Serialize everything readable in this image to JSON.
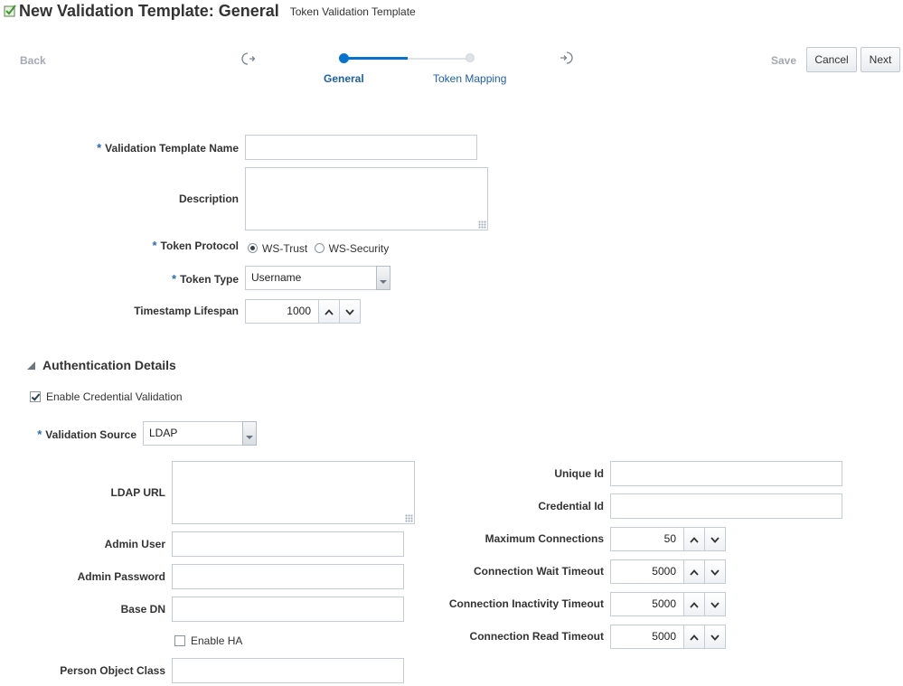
{
  "header": {
    "title": "New Validation Template: General",
    "subtitle": "Token Validation Template"
  },
  "train": {
    "back_label": "Back",
    "steps": [
      {
        "label": "General",
        "state": "current"
      },
      {
        "label": "Token Mapping",
        "state": "next"
      }
    ],
    "save_label": "Save",
    "cancel_label": "Cancel",
    "next_label": "Next"
  },
  "general": {
    "name_label": "Validation Template Name",
    "name_value": "",
    "description_label": "Description",
    "description_value": "",
    "protocol_label": "Token Protocol",
    "protocol_options": [
      "WS-Trust",
      "WS-Security"
    ],
    "protocol_selected": "WS-Trust",
    "token_type_label": "Token Type",
    "token_type_value": "Username",
    "timestamp_label": "Timestamp Lifespan",
    "timestamp_value": "1000"
  },
  "auth": {
    "section_title": "Authentication Details",
    "enable_credential_label": "Enable Credential Validation",
    "enable_credential_checked": true,
    "source_label": "Validation Source",
    "source_value": "LDAP",
    "ldap_url_label": "LDAP URL",
    "ldap_url_value": "",
    "admin_user_label": "Admin User",
    "admin_user_value": "",
    "admin_password_label": "Admin Password",
    "admin_password_value": "",
    "base_dn_label": "Base DN",
    "base_dn_value": "",
    "enable_ha_label": "Enable HA",
    "enable_ha_checked": false,
    "person_class_label": "Person Object Class",
    "person_class_value": "",
    "unique_id_label": "Unique Id",
    "unique_id_value": "",
    "credential_id_label": "Credential Id",
    "credential_id_value": "",
    "max_conn_label": "Maximum Connections",
    "max_conn_value": "50",
    "wait_timeout_label": "Connection Wait Timeout",
    "wait_timeout_value": "5000",
    "inactivity_timeout_label": "Connection Inactivity Timeout",
    "inactivity_timeout_value": "5000",
    "read_timeout_label": "Connection Read Timeout",
    "read_timeout_value": "5000"
  },
  "colors": {
    "accent": "#0572ce",
    "label_link": "#1e5fa8",
    "required_marker": "#2b6cb0"
  }
}
